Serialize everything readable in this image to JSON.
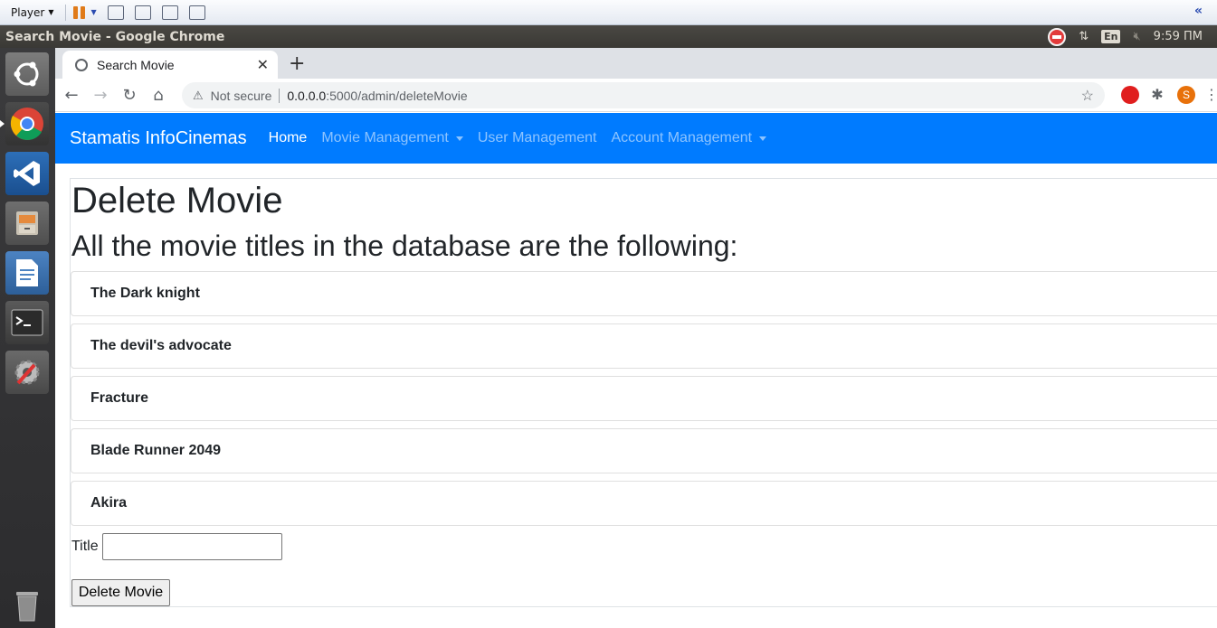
{
  "player_bar": {
    "menu_label": "Player"
  },
  "os_bar": {
    "window_title": "Search Movie - Google Chrome",
    "keyboard_layout": "En",
    "clock": "9:59 ПМ"
  },
  "browser": {
    "tab_title": "Search Movie",
    "address": {
      "security_label": "Not secure",
      "host": "0.0.0.0",
      "path": ":5000/admin/deleteMovie"
    },
    "profile_initial": "S"
  },
  "navbar": {
    "brand": "Stamatis InfoCinemas",
    "links": [
      {
        "label": "Home"
      },
      {
        "label": "Movie Management"
      },
      {
        "label": "User Management"
      },
      {
        "label": "Account Management"
      }
    ]
  },
  "content": {
    "heading": "Delete Movie",
    "subheading": "All the movie titles in the database are the following:",
    "movies": [
      {
        "title": "The Dark knight"
      },
      {
        "title": "The devil's advocate"
      },
      {
        "title": "Fracture"
      },
      {
        "title": "Blade Runner 2049"
      },
      {
        "title": "Akira"
      }
    ],
    "form": {
      "title_label": "Title",
      "title_value": "",
      "submit_label": "Delete Movie"
    }
  },
  "colors": {
    "navbar_bg": "#007bff",
    "launcher_bg": "#2c2c2e"
  }
}
